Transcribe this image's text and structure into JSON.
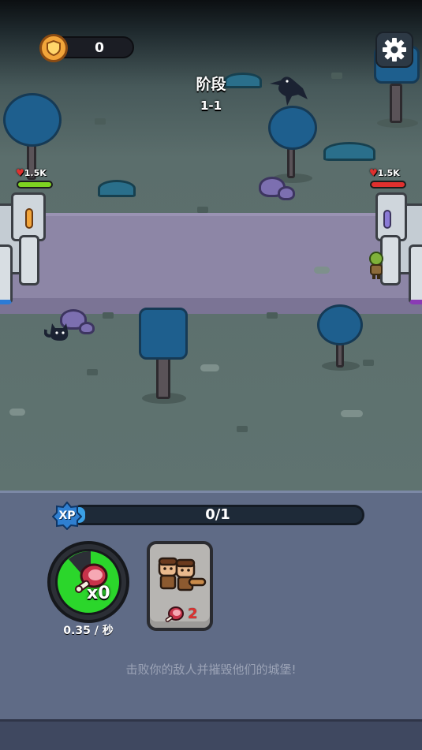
{
  "header": {
    "coins": "0",
    "stage_title": "阶段",
    "stage_number": "1-1"
  },
  "battle": {
    "player_castle_hp": "1.5K",
    "enemy_castle_hp": "1.5K"
  },
  "xp": {
    "label": "XP",
    "progress_text": "0/1",
    "progress": 0.04
  },
  "resources": {
    "meat_count": "x0",
    "meat_rate": "0.35 / 秒"
  },
  "units": [
    {
      "name": "warriors",
      "cost": "2"
    }
  ],
  "hint_text": "击败你的敌人并摧毁他们的城堡!",
  "icons": {
    "coin": "shield-coin-icon",
    "settings": "gear-icon",
    "xp": "xp-star-icon",
    "meat": "meat-icon",
    "health": "heart-icon"
  },
  "colors": {
    "player_hp": "#7ed321",
    "enemy_hp": "#e0302e",
    "meat_ring": "#2bd62b",
    "xp_fill": "#3aa0e6",
    "panel": "#5f6b86"
  }
}
